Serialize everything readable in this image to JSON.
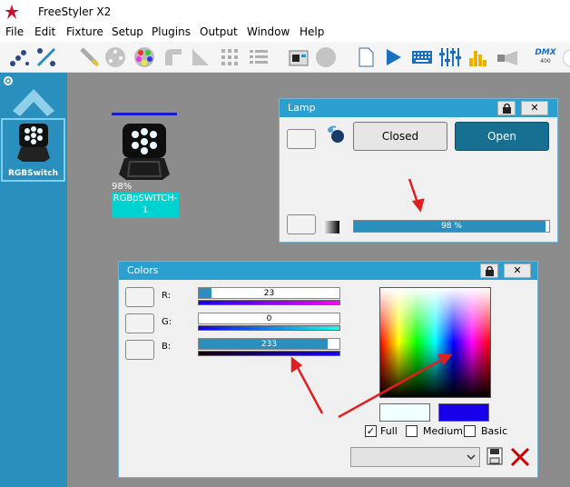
{
  "window": {
    "title": "FreeStyler X2"
  },
  "menu": [
    "File",
    "Edit",
    "Fixture",
    "Setup",
    "Plugins",
    "Output",
    "Window",
    "Help"
  ],
  "toolbar": {
    "dmx_badge_top": "DMX",
    "dmx_badge_bottom": "400"
  },
  "sidebar": {
    "fixture_label": "RGBSwitch"
  },
  "stage": {
    "fixture_percent": "98%",
    "fixture_name": "RGBpSWITCH-1"
  },
  "lamp": {
    "title": "Lamp",
    "closed_label": "Closed",
    "open_label": "Open",
    "dimmer_text": "98 %",
    "dimmer_value": 98
  },
  "colors": {
    "title": "Colors",
    "r_label": "R:",
    "g_label": "G:",
    "b_label": "B:",
    "r_value": "23",
    "g_value": "0",
    "b_value": "233",
    "r_level": 23,
    "g_level": 0,
    "b_level": 233,
    "full_label": "Full",
    "medium_label": "Medium",
    "basic_label": "Basic",
    "full_checked": true,
    "medium_checked": false,
    "basic_checked": false,
    "swatch_left": "#f0ffff",
    "swatch_right": "#1700e9"
  },
  "colors_theme": {
    "accent": "#2c9fd1",
    "arrow": "#e02020"
  }
}
